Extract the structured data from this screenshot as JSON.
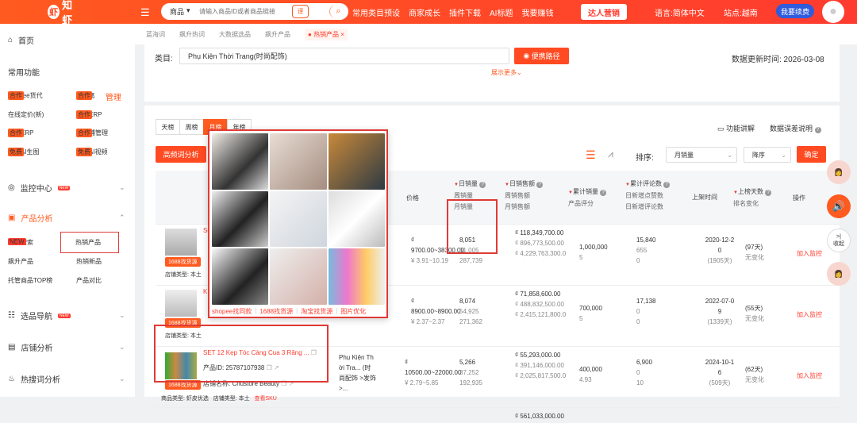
{
  "topbar": {
    "logo_text": "知虾",
    "menu_icon": "menu-icon",
    "search_category": "商品",
    "search_placeholder": "请输入商品ID或者商品链接",
    "search_badge": "译",
    "nav": [
      "常用类目预设",
      "商家成长",
      "插件下载",
      "AI标题",
      "我要赚钱"
    ],
    "nav_button": "达人营销",
    "language": "语言:简体中文",
    "site": "站点:越南",
    "vip": "我要续费",
    "accent": "#ff4a22"
  },
  "sidebar": {
    "home": "首页",
    "common": "常用功能",
    "manage": "管理",
    "tools": [
      {
        "label": "Shopee货代",
        "tag": "合作"
      },
      {
        "label": "IP隔离",
        "tag": "合作"
      },
      {
        "label": "在线定价(新)",
        "tag": ""
      },
      {
        "label": "虾皮ERP",
        "tag": "合作"
      },
      {
        "label": "巴西ERP",
        "tag": "合作"
      },
      {
        "label": "多店铺管理",
        "tag": "合作"
      },
      {
        "label": "免费AI生图",
        "tag": "免费"
      },
      {
        "label": "免费AI视频",
        "tag": "免费"
      }
    ],
    "monitor": "监控中心",
    "monitor_tag": "NEW",
    "product_analysis": "产品分析",
    "product_items": [
      "产品搜索",
      "热销产品",
      "飙升产品",
      "热销新品",
      "托管商品TOP榜",
      "产品对比"
    ],
    "product_search_tag": "NEW",
    "nav_select": "选品导航",
    "nav_select_tag": "NEW",
    "shop_analysis": "店铺分析",
    "keyword_analysis": "热搜词分析"
  },
  "breadcrumb": [
    "蓝海词",
    "飙升热词",
    "大数据选品",
    "飙升产品",
    "热销产品"
  ],
  "filter": {
    "category_label": "类目:",
    "category_value": "Phụ Kiện Thời Trang(时尚配饰)",
    "path_button": "便携路径",
    "more": "展示更多",
    "update_time": "数据更新时间: 2026-03-08"
  },
  "toolbar": {
    "tabs": [
      "天榜",
      "周榜",
      "月榜",
      "年榜"
    ],
    "active_tab": "月榜",
    "btn_hot": "高频词分析",
    "func": "功能讲解",
    "err": "数据误差说明",
    "sort_label": "排序:",
    "sort_value": "月销量",
    "order_value": "降序",
    "confirm": "确定"
  },
  "headers": {
    "price": "价格",
    "sales": [
      "日销量",
      "周销量",
      "月销量"
    ],
    "revenue": [
      "日销售额",
      "周销售额",
      "月销售额"
    ],
    "total": [
      "累计销量",
      "产品评分"
    ],
    "reviews": [
      "累计评论数",
      "日新增点赞数",
      "日新增评论数"
    ],
    "launch": "上架时间",
    "days": [
      "上榜天数",
      "排名变化"
    ],
    "op": "操作"
  },
  "rows": [
    {
      "name": "Set...",
      "source_btn": "1688找货源",
      "shop_type": "店铺类型: 本土",
      "price": "₫",
      "price_range": "9700.00~38300.00",
      "price_cny": "¥ 3.91~10.19",
      "daily": "8,051",
      "weekly": "61,005",
      "monthly": "287,739",
      "rev_day": "₫ 118,349,700.00",
      "rev_week": "₫ 896,773,500.00",
      "rev_month": "₫ 4,229,763,300.0",
      "total": "1,000,000",
      "rating": "5",
      "reviews": "15,840",
      "likes": "655",
      "new_reviews": "0",
      "launch_a": "2020-12-2",
      "launch_b": "0",
      "launch_days": "(1905天)",
      "days": "(97天)",
      "change": "无变化",
      "action": "加入监控"
    },
    {
      "name": "K...",
      "source_btn": "1688找货源",
      "shop_type": "店铺类型: 本土",
      "price": "₫",
      "price_range": "8900.00~8900.00",
      "price_cny": "¥ 2.37~2.37",
      "daily": "8,074",
      "weekly": "54,925",
      "monthly": "271,362",
      "rev_day": "₫ 71,858,600.00",
      "rev_week": "₫ 488,832,500.00",
      "rev_month": "₫ 2,415,121,800.0",
      "total": "700,000",
      "rating": "5",
      "reviews": "17,138",
      "likes": "0",
      "new_reviews": "0",
      "launch_a": "2022-07-0",
      "launch_b": "9",
      "launch_days": "(1339天)",
      "days": "(55天)",
      "change": "无变化",
      "action": "加入监控"
    },
    {
      "name": "SET 12 Kẹp Tóc Càng Cua 3 Răng ...",
      "product_id": "产品ID: 25787107938",
      "shop": "店铺名称: Chustore Beauty",
      "source_btn": "1688找货源",
      "meta": "商品类型: 虾皮优选",
      "shop_type": "店铺类型: 本土",
      "sku": "查看SKU",
      "cat": "Phụ Kiện Thời Tra... (时尚配饰 >发饰>...",
      "price": "₫",
      "price_range": "10500.00~22000.00",
      "price_cny": "¥ 2.79~5.85",
      "daily": "5,266",
      "weekly": "37,252",
      "monthly": "192,935",
      "rev_day": "₫ 55,293,000.00",
      "rev_week": "₫ 391,146,000.00",
      "rev_month": "₫ 2,025,817,500.0",
      "total": "400,000",
      "rating": "4.93",
      "reviews": "6,900",
      "likes": "0",
      "new_reviews": "10",
      "launch_a": "2024-10-1",
      "launch_b": "6",
      "launch_days": "(509天)",
      "days": "(62天)",
      "change": "无变化",
      "action": "加入监控"
    },
    {
      "rev_day": "₫ 561,033,000.00"
    }
  ],
  "popup": {
    "links": [
      "shopee找同款",
      "1688找货源",
      "淘宝找货源",
      "图片优化"
    ],
    "colors": [
      "#f2eee8",
      "#d8c8c0",
      "#b47a3a",
      "#2d3a42",
      "#e8eaec",
      "#444",
      "#ccc",
      "#d8a8a4",
      "#e07ad0"
    ]
  },
  "floating": {
    "collapse": "收起"
  }
}
